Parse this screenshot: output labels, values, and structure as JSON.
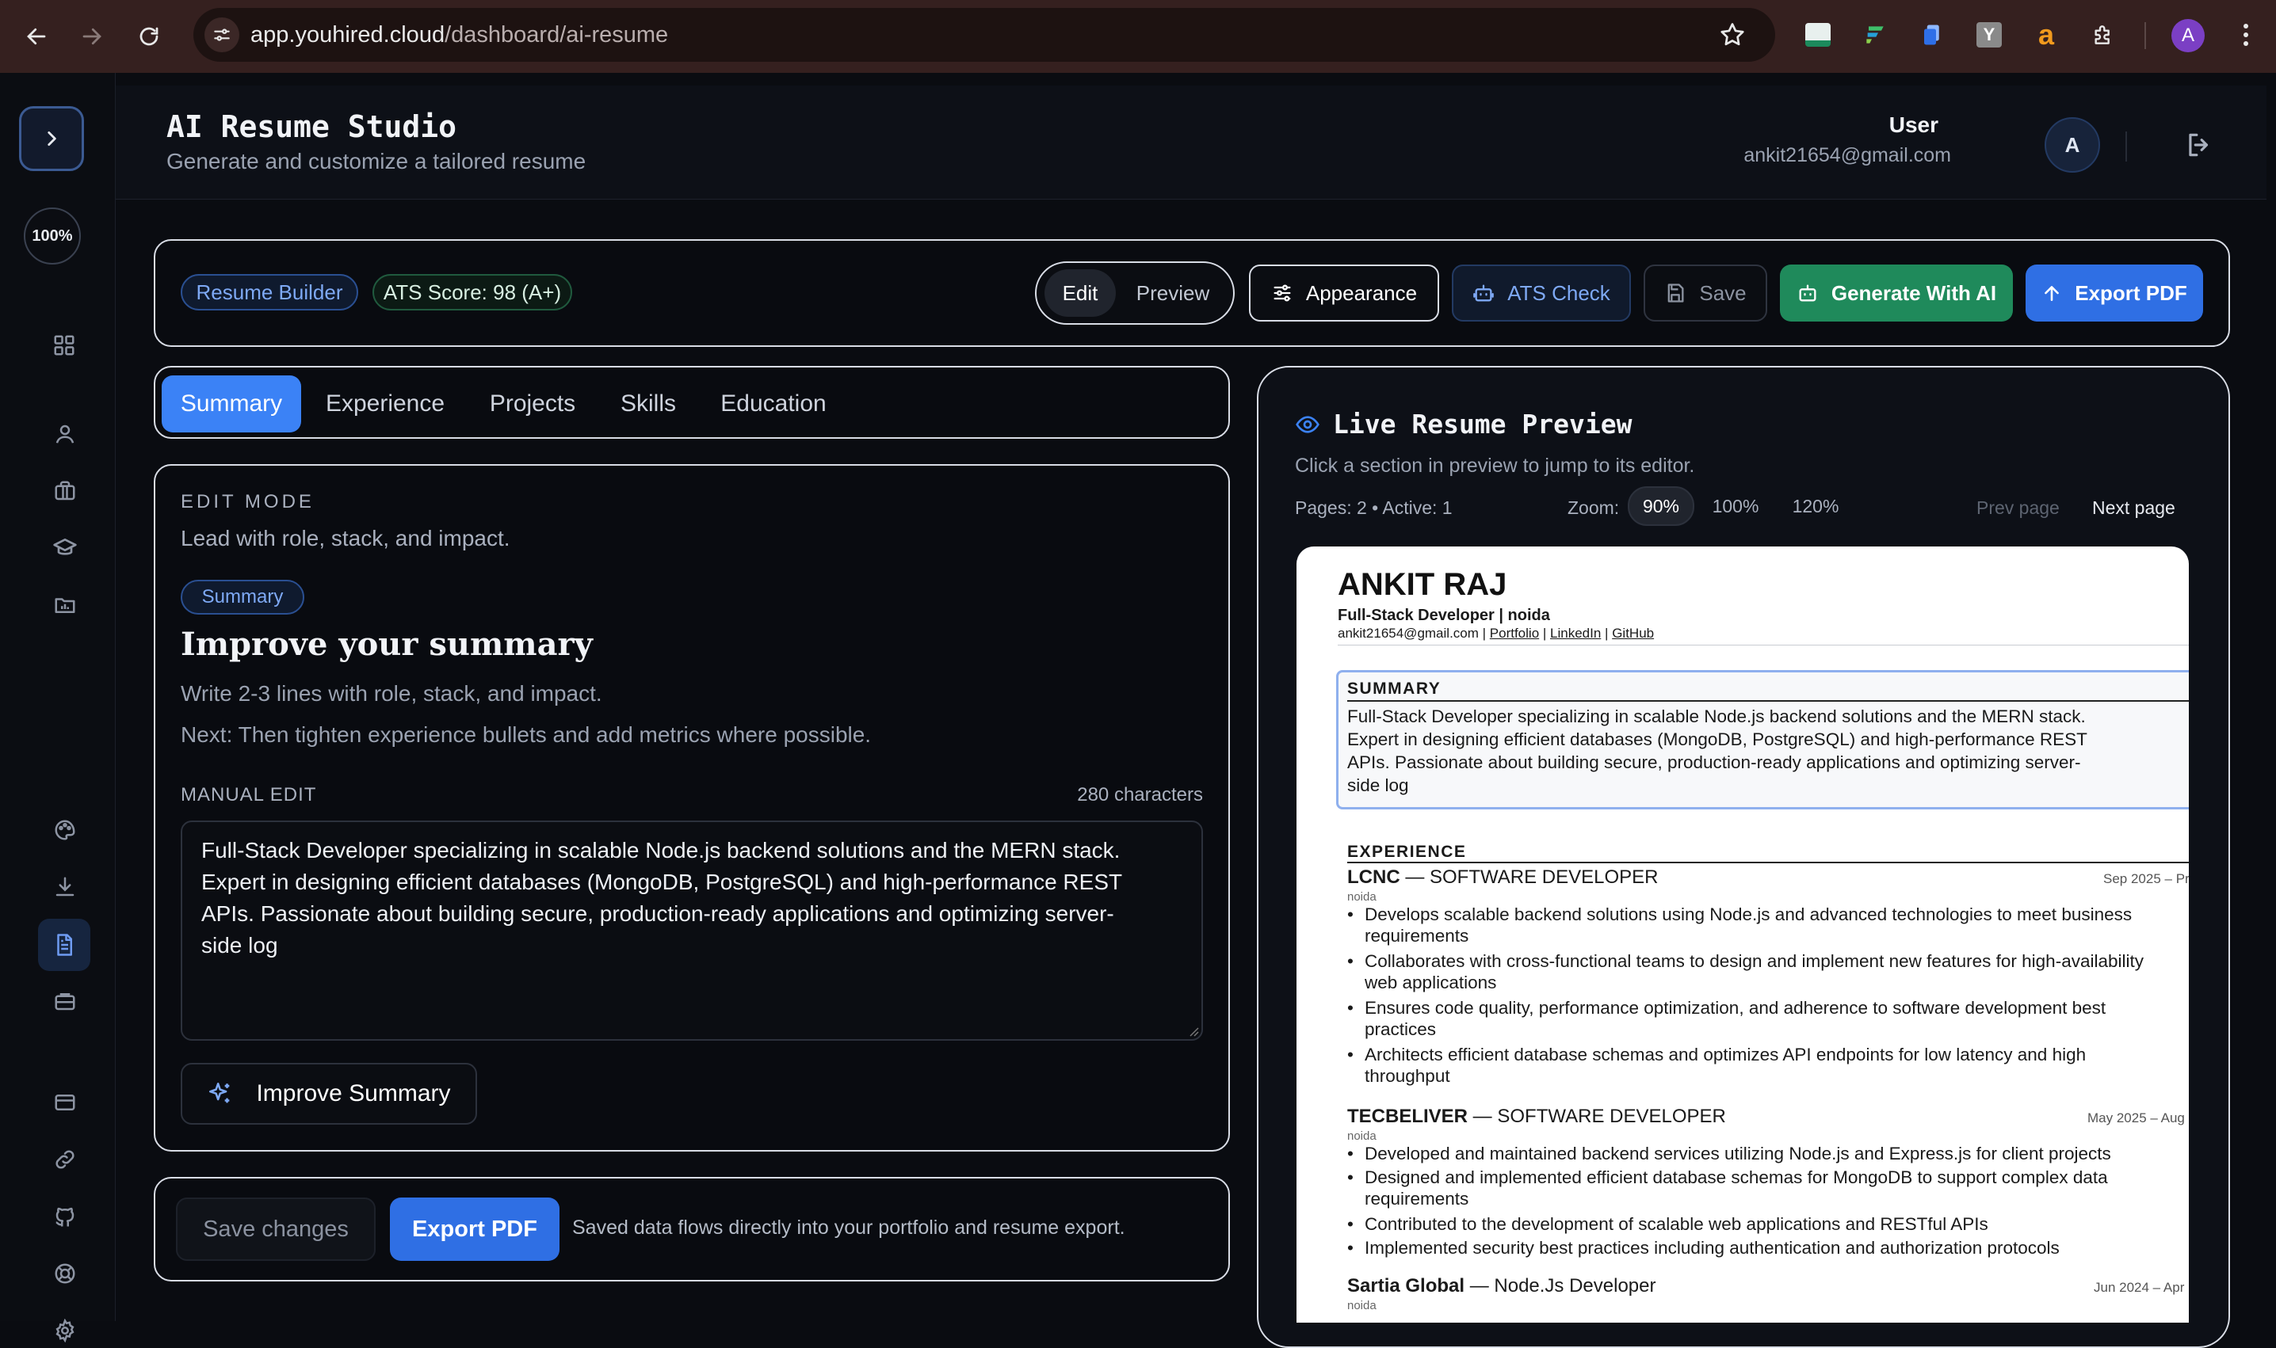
{
  "browser": {
    "url_domain": "app.youhired.cloud",
    "url_path": "/dashboard/ai-resume",
    "profile_initial": "A",
    "extensions": [
      "mail-ext-icon",
      "formula-ext-icon",
      "files-ext-icon",
      "y-ext-icon",
      "amazon-ext-icon",
      "puzzle-icon"
    ]
  },
  "sidebar": {
    "zoom_badge": "100%",
    "items": [
      "dashboard-icon",
      "user-icon",
      "briefcase-icon",
      "graduation-cap-icon",
      "folder-icon",
      "palette-icon",
      "download-icon",
      "document-icon",
      "toolbox-icon",
      "card-icon",
      "link-icon",
      "github-icon",
      "lifebuoy-icon",
      "settings-icon"
    ],
    "active": "document-icon"
  },
  "header": {
    "title": "AI Resume Studio",
    "subtitle": "Generate and customize a tailored resume",
    "user_name": "User",
    "user_email": "ankit21654@gmail.com",
    "avatar_initial": "A"
  },
  "toolbar": {
    "badge_builder": "Resume Builder",
    "badge_ats": "ATS Score: 98 (A+)",
    "mode_edit": "Edit",
    "mode_preview": "Preview",
    "appearance": "Appearance",
    "ats_check": "ATS Check",
    "save": "Save",
    "generate": "Generate With AI",
    "export": "Export PDF"
  },
  "tabs": [
    "Summary",
    "Experience",
    "Projects",
    "Skills",
    "Education"
  ],
  "editor": {
    "mode_label": "EDIT MODE",
    "mode_hint": "Lead with role, stack, and impact.",
    "section_badge": "Summary",
    "heading": "Improve your summary",
    "tip1": "Write 2-3 lines with role, stack, and impact.",
    "tip2": "Next: Then tighten experience bullets and add metrics where possible.",
    "manual_label": "MANUAL EDIT",
    "char_count": "280 characters",
    "text_lines": [
      "Full-Stack Developer specializing in scalable Node.js backend solutions and the MERN stack.",
      "Expert in designing efficient databases (MongoDB, PostgreSQL) and high-performance REST",
      "APIs. Passionate about building secure, production-ready applications and optimizing server-",
      "side log"
    ],
    "improve_button": "Improve Summary"
  },
  "footer": {
    "save_changes": "Save changes",
    "export": "Export PDF",
    "note": "Saved data flows directly into your portfolio and resume export."
  },
  "preview": {
    "title": "Live Resume Preview",
    "subtitle": "Click a section in preview to jump to its editor.",
    "pages": "Pages: 2 • Active: 1",
    "zoom_label": "Zoom:",
    "zoom_options": [
      "90%",
      "100%",
      "120%"
    ],
    "zoom_selected": "90%",
    "prev_page": "Prev page",
    "next_page": "Next page"
  },
  "resume": {
    "name": "ANKIT RAJ",
    "headline": "Full-Stack Developer | noida",
    "email": "ankit21654@gmail.com",
    "links": [
      "Portfolio",
      "LinkedIn",
      "GitHub"
    ],
    "summary_title": "SUMMARY",
    "summary_lines": [
      "Full-Stack Developer specializing in scalable Node.js backend solutions and the MERN stack.",
      "Expert in designing efficient databases (MongoDB, PostgreSQL) and high-performance REST",
      "APIs. Passionate about building secure, production-ready applications and optimizing server-",
      "side log"
    ],
    "experience_title": "EXPERIENCE",
    "jobs": [
      {
        "company": "LCNC",
        "role": " — SOFTWARE DEVELOPER",
        "date": "Sep 2025 – Pr",
        "location": "noida",
        "bullets": [
          "Develops scalable backend solutions using Node.js and advanced technologies to meet business",
          "requirements",
          "Collaborates with cross-functional teams to design and implement new features for high-availability",
          "web applications",
          "Ensures code quality, performance optimization, and adherence to software development best",
          "practices",
          "Architects efficient database schemas and optimizes API endpoints for low latency and high",
          "throughput"
        ]
      },
      {
        "company": "TECBELIVER",
        "role": " — SOFTWARE DEVELOPER",
        "date": "May 2025 – Aug",
        "location": "noida",
        "bullets": [
          "Developed and maintained backend services utilizing Node.js and Express.js for client projects",
          "Designed and implemented efficient database schemas for MongoDB to support complex data",
          "requirements",
          "Contributed to the development of scalable web applications and RESTful APIs",
          "Implemented security best practices including authentication and authorization protocols"
        ]
      },
      {
        "company": "Sartia Global",
        "role": " — Node.Js Developer",
        "date": "Jun 2024 – Apr",
        "location": "noida"
      }
    ]
  },
  "colors": {
    "accent_blue": "#2f6fe4",
    "accent_green": "#1f8a5b",
    "bg": "#0a0c11"
  }
}
